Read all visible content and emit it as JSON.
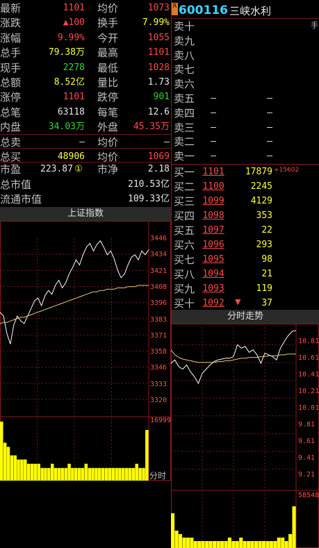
{
  "stats": [
    {
      "l1": "最新",
      "v1": "1101",
      "c1": "red",
      "l2": "均价",
      "v2": "1073",
      "c2": "red"
    },
    {
      "l1": "涨跌",
      "v1": "▲100",
      "c1": "red",
      "l2": "换手",
      "v2": "7.99%",
      "c2": "yel"
    },
    {
      "l1": "涨幅",
      "v1": "9.99%",
      "c1": "red",
      "l2": "今开",
      "v2": "1055",
      "c2": "red"
    },
    {
      "l1": "总手",
      "v1": "79.38万",
      "c1": "yel",
      "l2": "最高",
      "v2": "1101",
      "c2": "red"
    },
    {
      "l1": "现手",
      "v1": "2278",
      "c1": "grn",
      "l2": "最低",
      "v2": "1028",
      "c2": "red"
    },
    {
      "l1": "总额",
      "v1": "8.52亿",
      "c1": "yel",
      "l2": "量比",
      "v2": "1.73",
      "c2": "wht"
    },
    {
      "l1": "涨停",
      "v1": "1101",
      "c1": "red",
      "l2": "跌停",
      "v2": "901",
      "c2": "grn"
    },
    {
      "l1": "总笔",
      "v1": "63118",
      "c1": "wht",
      "l2": "每笔",
      "v2": "12.6",
      "c2": "wht"
    },
    {
      "l1": "内盘",
      "v1": "34.03万",
      "c1": "grn",
      "l2": "外盘",
      "v2": "45.35万",
      "c2": "red"
    },
    {
      "l1": "总卖",
      "v1": "–",
      "c1": "wht",
      "l2": "均价",
      "v2": "–",
      "c2": "wht"
    },
    {
      "l1": "总买",
      "v1": "48906",
      "c1": "yel",
      "l2": "均价",
      "v2": "1069",
      "c2": "red"
    }
  ],
  "valuation": {
    "pe_label": "市盈",
    "pe_value": "223.87",
    "pe_badge": "①",
    "pb_label": "市净",
    "pb_value": "2.18",
    "total_mv_label": "总市值",
    "total_mv_value": "210.53亿",
    "float_mv_label": "流通市值",
    "float_mv_value": "109.33亿"
  },
  "stock": {
    "badge": "R",
    "code": "600116",
    "name": "三峡水利",
    "right_marker": "手"
  },
  "asks": [
    {
      "label": "卖十",
      "price": "",
      "vol": ""
    },
    {
      "label": "卖九",
      "price": "",
      "vol": ""
    },
    {
      "label": "卖八",
      "price": "",
      "vol": ""
    },
    {
      "label": "卖七",
      "price": "",
      "vol": ""
    },
    {
      "label": "卖六",
      "price": "",
      "vol": ""
    },
    {
      "label": "卖五",
      "price": "–",
      "vol": "–"
    },
    {
      "label": "卖四",
      "price": "–",
      "vol": "–"
    },
    {
      "label": "卖三",
      "price": "–",
      "vol": "–"
    },
    {
      "label": "卖二",
      "price": "–",
      "vol": "–"
    },
    {
      "label": "卖一",
      "price": "–",
      "vol": "–"
    }
  ],
  "bids": [
    {
      "label": "买一",
      "price": "1101",
      "vol": "17879",
      "extra": "+15602"
    },
    {
      "label": "买二",
      "price": "1100",
      "vol": "2245",
      "extra": ""
    },
    {
      "label": "买三",
      "price": "1099",
      "vol": "4129",
      "extra": ""
    },
    {
      "label": "买四",
      "price": "1098",
      "vol": "353",
      "extra": ""
    },
    {
      "label": "买五",
      "price": "1097",
      "vol": "22",
      "extra": ""
    },
    {
      "label": "买六",
      "price": "1096",
      "vol": "293",
      "extra": ""
    },
    {
      "label": "买七",
      "price": "1095",
      "vol": "98",
      "extra": ""
    },
    {
      "label": "买八",
      "price": "1094",
      "vol": "21",
      "extra": ""
    },
    {
      "label": "买九",
      "price": "1093",
      "vol": "119",
      "extra": ""
    },
    {
      "label": "买十",
      "price": "1092",
      "vol": "37",
      "extra": ""
    }
  ],
  "chart_data": [
    {
      "type": "line",
      "title": "上证指数",
      "ylabels": [
        "3446",
        "3434",
        "3421",
        "3408",
        "3396",
        "3383",
        "3371",
        "3358",
        "3346",
        "3333",
        "3320"
      ],
      "volume_label": "16999",
      "time_label": "分时",
      "series": [
        {
          "values": [
            3395,
            3392,
            3378,
            3370,
            3385,
            3392,
            3388,
            3386,
            3392,
            3398,
            3404,
            3406,
            3400,
            3408,
            3412,
            3409,
            3416,
            3420,
            3414,
            3418,
            3425,
            3430,
            3436,
            3432,
            3440,
            3446,
            3449,
            3443,
            3448,
            3451,
            3446,
            3440,
            3443,
            3437,
            3428,
            3422,
            3425,
            3432,
            3438,
            3440,
            3436,
            3443,
            3440,
            3444
          ]
        },
        {
          "values": [
            3386,
            3387,
            3387,
            3388,
            3389,
            3390,
            3391,
            3391,
            3392,
            3393,
            3394,
            3395,
            3396,
            3397,
            3398,
            3399,
            3400,
            3401,
            3402,
            3403,
            3404,
            3405,
            3406,
            3407,
            3408,
            3409,
            3410,
            3411,
            3411,
            3412,
            3412,
            3413,
            3413,
            3413,
            3414,
            3414,
            3414,
            3415,
            3415,
            3415,
            3416,
            3416,
            3416,
            3416
          ]
        }
      ],
      "volume": [
        14,
        9,
        8,
        6,
        6,
        5,
        5,
        5,
        4,
        4,
        4,
        4,
        3,
        3,
        3,
        4,
        3,
        3,
        3,
        3,
        4,
        3,
        3,
        3,
        3,
        4,
        3,
        3,
        3,
        3,
        3,
        3,
        3,
        3,
        3,
        3,
        3,
        3,
        3,
        3,
        4,
        3,
        3,
        12
      ]
    },
    {
      "type": "line",
      "title": "分时走势",
      "ylabels": [
        "10.81",
        "10.61",
        "10.41",
        "10.21",
        "10.01",
        "9.81",
        "9.61",
        "9.41",
        "9.21"
      ],
      "volume_label": "58548",
      "series": [
        {
          "values": [
            10.62,
            10.66,
            10.58,
            10.55,
            10.6,
            10.52,
            10.46,
            10.38,
            10.5,
            10.55,
            10.6,
            10.64,
            10.66,
            10.67,
            10.68,
            10.68,
            10.7,
            10.84,
            10.8,
            10.82,
            10.75,
            10.78,
            10.72,
            10.62,
            10.74,
            10.72,
            10.7,
            10.66,
            10.8,
            10.88,
            10.95,
            11.0,
            11.01
          ]
        },
        {
          "values": [
            10.78,
            10.72,
            10.69,
            10.67,
            10.66,
            10.65,
            10.64,
            10.63,
            10.63,
            10.63,
            10.63,
            10.63,
            10.64,
            10.64,
            10.65,
            10.65,
            10.66,
            10.67,
            10.68,
            10.68,
            10.69,
            10.69,
            10.69,
            10.7,
            10.7,
            10.71,
            10.71,
            10.71,
            10.72,
            10.72,
            10.73,
            10.73,
            10.73
          ]
        }
      ],
      "volume": [
        10,
        5,
        4,
        3,
        3,
        3,
        2,
        2,
        2,
        2,
        2,
        2,
        2,
        2,
        2,
        3,
        2,
        2,
        3,
        2,
        2,
        2,
        2,
        2,
        2,
        2,
        2,
        2,
        3,
        3,
        2,
        4,
        12
      ]
    }
  ]
}
